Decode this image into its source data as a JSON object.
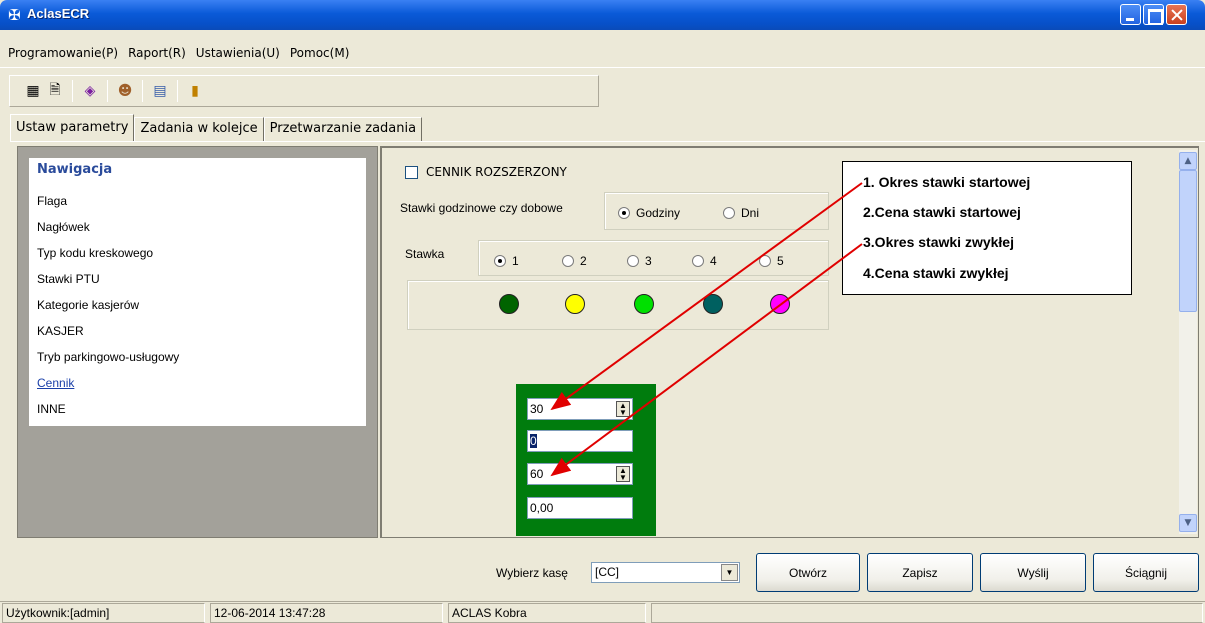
{
  "window": {
    "title": "AclasECR"
  },
  "menu": [
    "Programowanie(P)",
    "Raport(R)",
    "Ustawienia(U)",
    "Pomoc(M)"
  ],
  "toolbar": {
    "icons": [
      "grid-icon",
      "document-icon",
      "palette-icon",
      "users-icon",
      "config-icon",
      "exit-door-icon"
    ]
  },
  "tabs": [
    "Ustaw parametry",
    "Zadania w kolejce",
    "Przetwarzanie zadania"
  ],
  "nav": {
    "title": "Nawigacja",
    "items": [
      "Flaga",
      "Nagłówek",
      "Typ kodu kreskowego",
      "Stawki PTU",
      "Kategorie kasjerów",
      "KASJER",
      "Tryb parkingowo-usługowy",
      "Cennik",
      "INNE"
    ]
  },
  "form": {
    "cennik_rozszerzony": "CENNIK ROZSZERZONY",
    "stawki_label": "Stawki godzinowe czy dobowe",
    "godziny": "Godziny",
    "dni": "Dni",
    "stawka_label": "Stawka",
    "stawka_options": [
      "1",
      "2",
      "3",
      "4",
      "5"
    ],
    "stawka_selected": "1",
    "colors": [
      "#006400",
      "#ffff00",
      "#00e000",
      "#006060",
      "#ff00ff"
    ],
    "fields": [
      "30",
      "0",
      "60",
      "0,00"
    ]
  },
  "annotation": {
    "lines": [
      "1. Okres stawki startowej",
      "2.Cena stawki startowej",
      "3.Okres stawki zwykłej",
      "4.Cena stawki zwykłej"
    ]
  },
  "bottom": {
    "wybierz_label": "Wybierz kasę",
    "kasa_value": "[CC]",
    "buttons": [
      "Otwórz",
      "Zapisz",
      "Wyślij",
      "Ściągnij"
    ]
  },
  "status": {
    "user": "Użytkownik:[admin]",
    "datetime": "12-06-2014 13:47:28",
    "device": "ACLAS Kobra"
  }
}
